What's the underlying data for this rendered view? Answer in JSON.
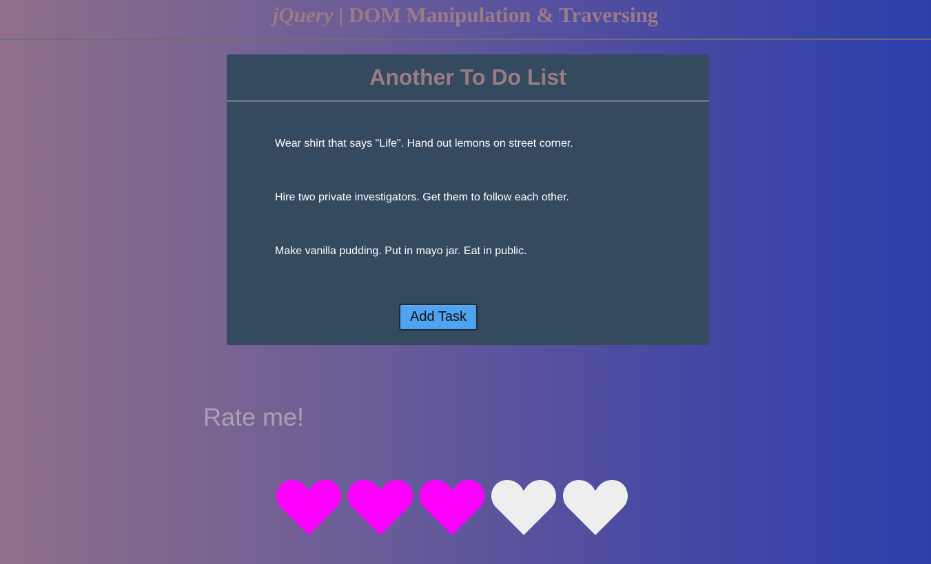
{
  "header": {
    "title_library": "jQuery",
    "title_rest": " | DOM Manipulation & Traversing"
  },
  "todo": {
    "title": "Another To Do List",
    "tasks": [
      "Wear shirt that says \"Life\". Hand out lemons on street corner.",
      "Hire two private investigators. Get them to follow each other.",
      "Make vanilla pudding. Put in mayo jar. Eat in public."
    ],
    "add_button_label": "Add Task"
  },
  "rating": {
    "label": "Rate me!",
    "value": 3,
    "max": 5,
    "icon": "heart-icon",
    "active_color": "#ff00ff",
    "inactive_color": "#eeeeee"
  }
}
